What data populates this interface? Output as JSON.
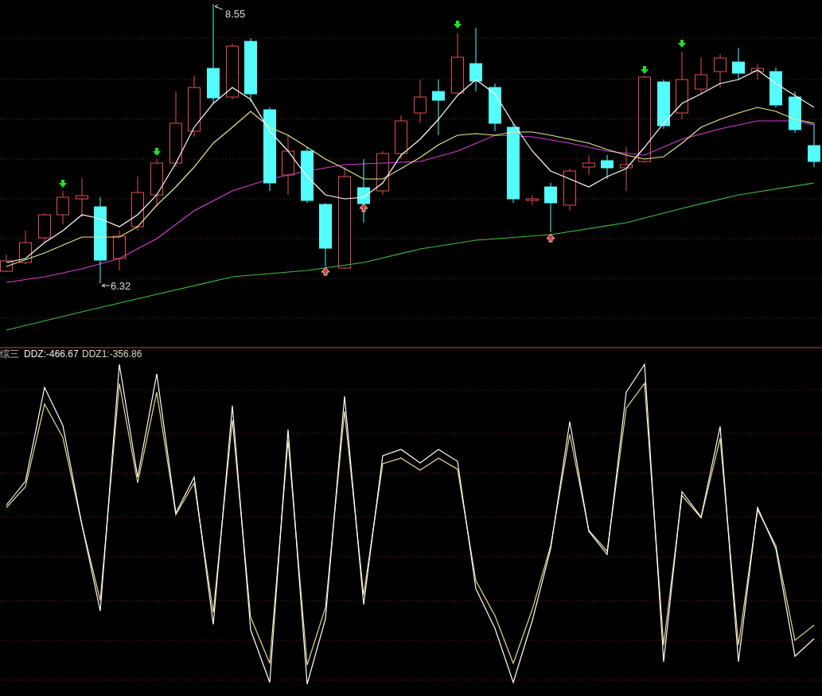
{
  "main_chart": {
    "high_label": "8.55",
    "low_label": "6.32"
  },
  "indicator_panel": {
    "title": "综三",
    "readings": [
      "DDZ:-466.67",
      "DDZ1:-356.86"
    ]
  }
}
